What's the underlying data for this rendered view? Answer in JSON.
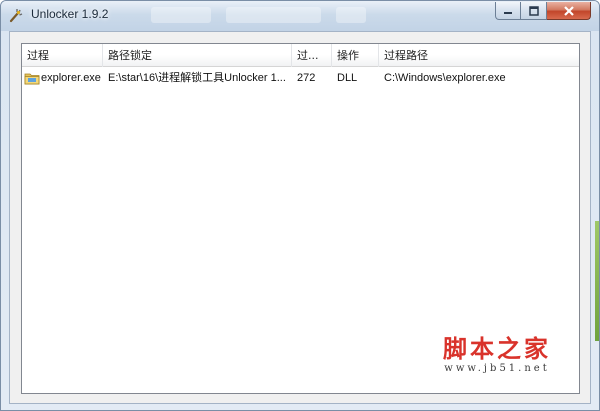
{
  "window": {
    "title": "Unlocker 1.9.2",
    "app_icon": "wand-icon",
    "controls": {
      "minimize": "minimize-icon",
      "maximize": "maximize-icon",
      "close": "close-icon"
    }
  },
  "list": {
    "columns": [
      "过程",
      "路径锁定",
      "过...",
      "操作",
      "过程路径"
    ],
    "rows": [
      {
        "icon": "explorer-file-icon",
        "process": "explorer.exe",
        "path_locked": "E:\\star\\16\\进程解锁工具Unlocker 1...",
        "pid": "272",
        "action": "DLL",
        "process_path": "C:\\Windows\\explorer.exe"
      }
    ]
  },
  "watermark": {
    "main": "脚本之家",
    "sub": "www.jb51.net"
  },
  "colors": {
    "watermark_red": "#d9332b",
    "titlebar": "#cbdaea",
    "close_button": "#c2462a"
  }
}
